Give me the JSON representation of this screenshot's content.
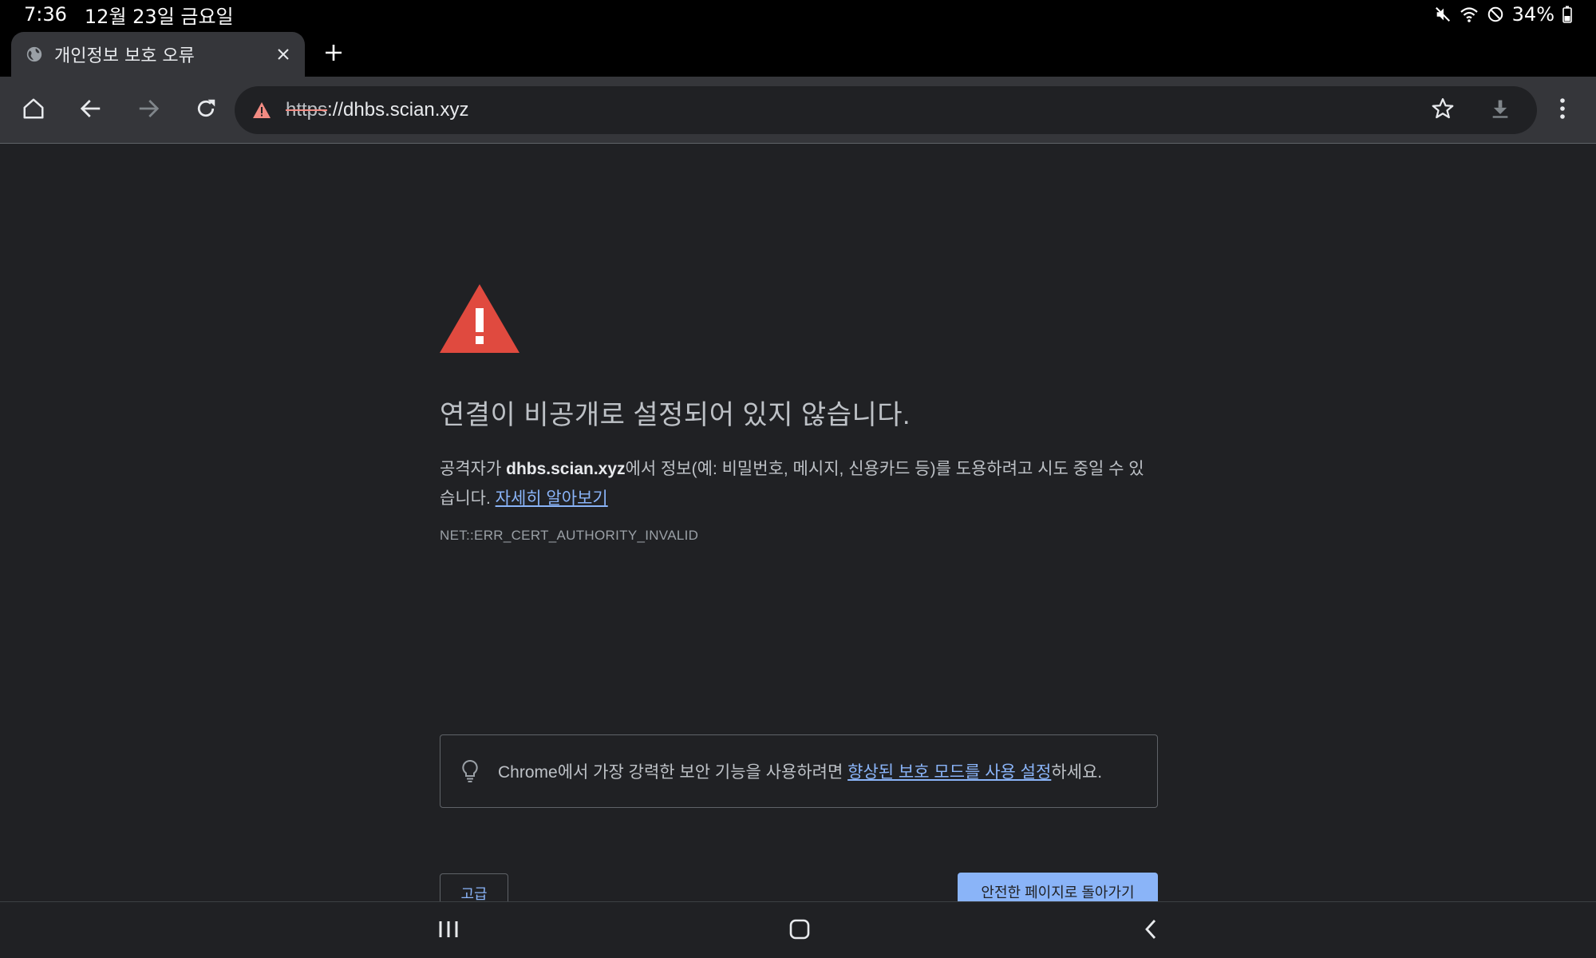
{
  "status_bar": {
    "time": "7:36",
    "date": "12월 23일 금요일",
    "battery": "34%",
    "icons": [
      "mute-icon",
      "wifi-icon",
      "do-not-disturb-icon",
      "battery-icon"
    ]
  },
  "tab": {
    "title": "개인정보 보호 오류",
    "favicon": "globe-icon"
  },
  "toolbar": {
    "url_scheme": "https",
    "url_rest": "://dhbs.scian.xyz",
    "icons": [
      "home-icon",
      "back-icon",
      "forward-icon",
      "reload-icon",
      "warning-icon",
      "star-icon",
      "download-icon",
      "more-icon"
    ]
  },
  "interstitial": {
    "heading": "연결이 비공개로 설정되어 있지 않습니다.",
    "explanation_prefix": "공격자가 ",
    "hostname": "dhbs.scian.xyz",
    "explanation_suffix": "에서 정보(예: 비밀번호, 메시지, 신용카드 등)를 도용하려고 시도 중일 수 있습니다. ",
    "learn_more": "자세히 알아보기",
    "error_code": "NET::ERR_CERT_AUTHORITY_INVALID",
    "tip_prefix": "Chrome에서 가장 강력한 보안 기능을 사용하려면 ",
    "tip_link": "향상된 보호 모드를 사용 설정",
    "tip_suffix": "하세요.",
    "advanced_button": "고급",
    "back_button": "안전한 페이지로 돌아가기"
  },
  "colors": {
    "background": "#202124",
    "toolbar": "#35363a",
    "warning_red": "#d93025",
    "link_blue": "#8ab4f8"
  },
  "nav_bar": {
    "icons": [
      "recents-icon",
      "home-nav-icon",
      "back-nav-icon"
    ]
  }
}
